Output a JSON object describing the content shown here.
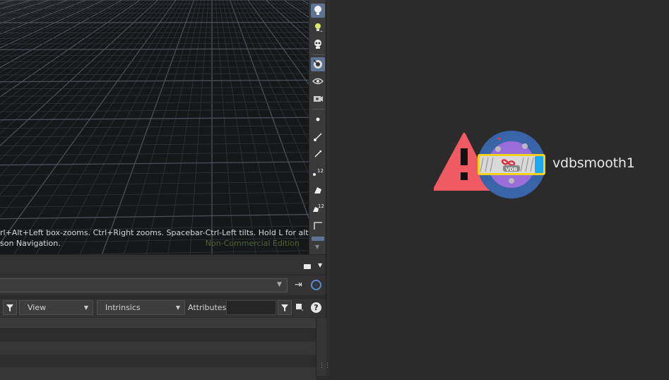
{
  "viewport": {
    "hint_line1": "rl+Alt+Left box-zooms. Ctrl+Right zooms. Spacebar-Ctrl-Left tilts. Hold L for alternate",
    "hint_line2": "son Navigation.",
    "watermark": "Non-Commercial Edition"
  },
  "toolbar": {
    "tools": [
      {
        "icon": "lightbulb-icon",
        "active": true
      },
      {
        "icon": "light-add-icon",
        "active": false
      },
      {
        "icon": "skull-icon",
        "active": false
      },
      {
        "icon": "camera-view-icon",
        "active": true
      },
      {
        "icon": "eye-visibility-icon",
        "active": false
      },
      {
        "icon": "ghost-camera-icon",
        "active": false
      },
      {
        "icon": "point-icon",
        "active": false
      },
      {
        "icon": "edge-icon",
        "active": false
      },
      {
        "icon": "normal-icon",
        "active": false
      },
      {
        "icon": "point-number-icon",
        "active": false,
        "badge": "12"
      },
      {
        "icon": "primitive-icon",
        "active": false
      },
      {
        "icon": "primitive-number-icon",
        "active": false,
        "badge": "12"
      },
      {
        "icon": "corner-icon",
        "active": false
      }
    ]
  },
  "spreadsheet": {
    "view_label": "View",
    "intrinsics_label": "Intrinsics",
    "attributes_label": "Attributes:",
    "attributes_value": "",
    "help_label": "?"
  },
  "network": {
    "node_name": "vdbsmooth1",
    "node_badge": "VDB",
    "warning_color": "#f05a63",
    "node_ring_color": "#3a64a8",
    "node_inner_color": "#9a6dd8",
    "selection_color": "#f2d21f",
    "display_flag_color": "#1fa8f2"
  }
}
